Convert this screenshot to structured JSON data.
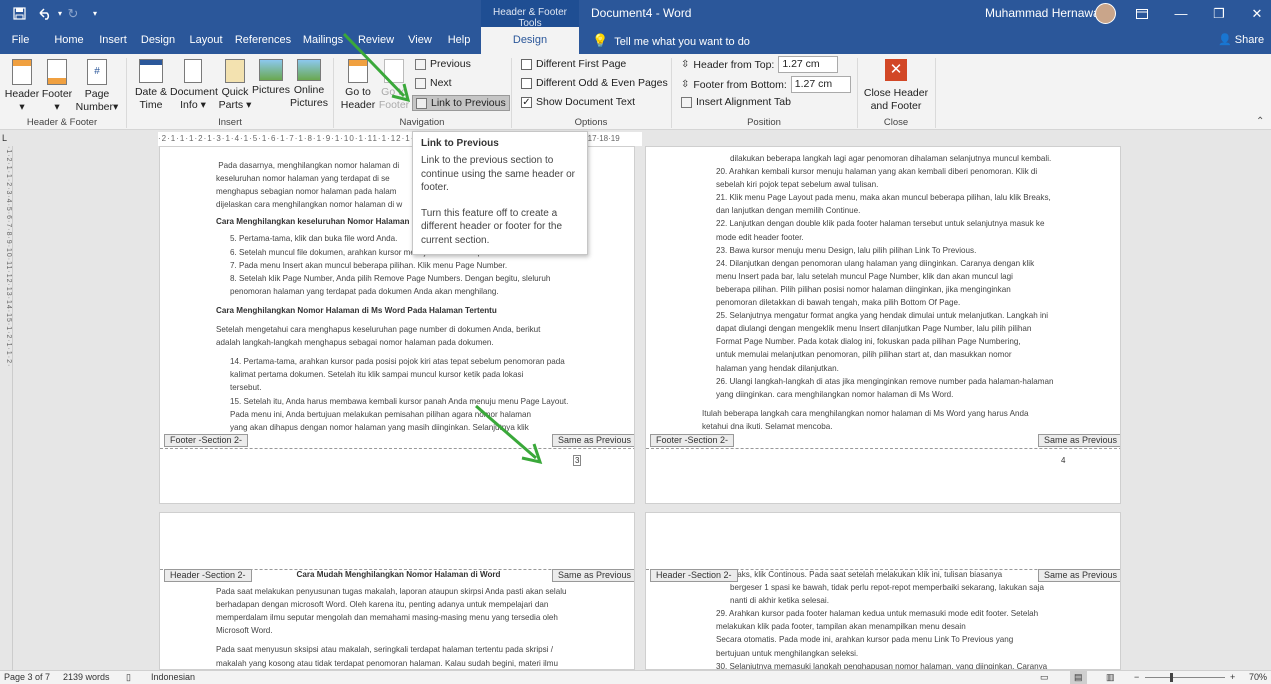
{
  "title_bar": {
    "contextual_tab_group": "Header & Footer Tools",
    "document_title": "Document4 - Word",
    "user_name": "Muhammad Hernawan"
  },
  "tabs": [
    {
      "label": "File"
    },
    {
      "label": "Home"
    },
    {
      "label": "Insert"
    },
    {
      "label": "Design"
    },
    {
      "label": "Layout"
    },
    {
      "label": "References"
    },
    {
      "label": "Mailings"
    },
    {
      "label": "Review"
    },
    {
      "label": "View"
    },
    {
      "label": "Help"
    },
    {
      "label": "Design",
      "active": true
    }
  ],
  "tell_me": "Tell me what you want to do",
  "share": "Share",
  "ribbon": {
    "header_footer": {
      "label": "Header & Footer",
      "header": "Header",
      "footer": "Footer",
      "page_number_1": "Page",
      "page_number_2": "Number"
    },
    "insert": {
      "label": "Insert",
      "date_1": "Date &",
      "date_2": "Time",
      "docinfo_1": "Document",
      "docinfo_2": "Info",
      "quick_1": "Quick",
      "quick_2": "Parts",
      "pictures": "Pictures",
      "online_1": "Online",
      "online_2": "Pictures"
    },
    "navigation": {
      "label": "Navigation",
      "goto_header_1": "Go to",
      "goto_header_2": "Header",
      "goto_footer_1": "Go to",
      "goto_footer_2": "Footer",
      "previous": "Previous",
      "next": "Next",
      "link_to_previous": "Link to Previous"
    },
    "options": {
      "label": "Options",
      "diff_first": "Different First Page",
      "diff_odd_even": "Different Odd & Even Pages",
      "show_doc_text": "Show Document Text",
      "show_doc_text_checked": true
    },
    "position": {
      "label": "Position",
      "header_from_top_label": "Header from Top:",
      "header_from_top": "1.27 cm",
      "footer_from_bottom_label": "Footer from Bottom:",
      "footer_from_bottom": "1.27 cm",
      "insert_alignment_tab": "Insert Alignment Tab"
    },
    "close": {
      "label": "Close",
      "close_1": "Close Header",
      "close_2": "and Footer"
    }
  },
  "tooltip": {
    "title": "Link to Previous",
    "p1": "Link to the previous section to continue using the same header or footer.",
    "p2": "Turn this feature off to create a different header or footer for the current section."
  },
  "ruler": {
    "top": "·2·1·1·1·2·1·3·1·4·1·5·1·6·1·7·1·8·1·9·1·10·1·11·1·12·1·13·1·14·1·15·1·16",
    "top_end": "·17·18·19"
  },
  "pages": {
    "p3_body": {
      "para1_l1": "Pada dasarnya, menghilangkan nomor halaman di",
      "para1_l2": "keseluruhan nomor halaman yang terdapat di se",
      "para1_l3": "menghapus sebagian nomor halaman pada halam",
      "para1_l4": "dijelaskan cara menghilangkan nomor halaman di w",
      "heading1": "Cara Menghilangkan keseluruhan Nomor Halaman",
      "li5": "5.   Pertama-tama, klik dan buka file word Anda.",
      "li6": "6.   Setelah muncul file dokumen, arahkan kursor menuju menu Insert pada bar.",
      "li7": "7.   Pada menu Insert akan muncul beberapa pilihan. Klik menu Page Number.",
      "li8a": "8.   Setelah klik Page Number, Anda pilih Remove Page Numbers. Dengan begitu, sleluruh",
      "li8b": "      penomoran halaman yang terdapat pada dokumen Anda akan menghilang.",
      "heading2": "Cara Menghilangkan Nomor Halaman di Ms Word Pada Halaman Tertentu",
      "para2_l1": "Setelah mengetahui cara menghapus keseluruhan page number di dokumen Anda, berikut",
      "para2_l2": "adalah langkah-langkah menghapus sebagai nomor halaman pada dokumen.",
      "li14a": "14. Pertama-tama, arahkan kursor pada posisi pojok kiri atas tepat sebelum penomoran pada",
      "li14b": "      kalimat pertama dokumen. Setelah itu klik sampai muncul kursor ketik pada lokasi",
      "li14c": "      tersebut.",
      "li15a": "15. Setelah itu, Anda harus membawa kembali kursor panah Anda menuju menu Page Layout.",
      "li15b": "      Pada menu ini, Anda bertujuan melakukan pemisahan pilihan agara nomor halaman",
      "li15c": "      yang akan dihapus dengan nomor halaman yang masih diinginkan. Selanjutnya klik"
    },
    "p4_body": {
      "l0": "dilakukan beberapa langkah lagi agar penomoran dihalaman selanjutnya muncul kembali.",
      "li20a": "20. Arahkan kembali kursor menuju halaman yang akan kembali diberi penomoran. Klik di",
      "li20b": "      sebelah kiri pojok tepat sebelum awal tulisan.",
      "li21a": "21. Klik menu Page Layout pada menu, maka akan muncul beberapa pilihan, lalu klik Breaks,",
      "li21b": "      dan lanjutkan dengan memilih Continue.",
      "li22a": "22. Lanjutkan dengan double klik pada footer halaman tersebut untuk selanjutnya masuk ke",
      "li22b": "      mode edit header footer.",
      "li23": "23. Bawa kursor menuju menu Design, lalu pilih pilihan Link To Previous.",
      "li24a": "24. Dilanjutkan dengan penomoran ulang halaman yang diinginkan. Caranya dengan klik",
      "li24b": "      menu Insert pada bar, lalu setelah muncul Page Number, klik dan akan muncul lagi",
      "li24c": "      beberapa pilihan. Pilih pilihan posisi nomor halaman diinginkan, jika menginginkan",
      "li24d": "      penomoran diletakkan di bawah tengah, maka pilih Bottom Of Page.",
      "li25a": "25. Selanjutnya mengatur format angka yang hendak dimulai untuk melanjutkan. Langkah ini",
      "li25b": "      dapat diulangi dengan mengeklik menu Insert dilanjutkan Page Number, lalu pilih pilihan",
      "li25c": "      Format Page Number. Pada kotak dialog ini, fokuskan pada pilihan Page Numbering,",
      "li25d": "      untuk memulai melanjutkan penomoran, pilih pilihan start at, dan masukkan nomor",
      "li25e": "      halaman yang hendak dilanjutkan.",
      "li26a": "26. Ulangi langkah-langkah di atas jika menginginkan remove number pada halaman-halaman",
      "li26b": "      yang diinginkan.  cara menghilangkan nomor halaman di Ms Word.",
      "end1": "Itulah beberapa langkah cara menghilangkan nomor halaman di Ms Word yang harus Anda",
      "end2": "ketahui dna ikuti. Selamat mencoba."
    },
    "p5_body": {
      "heading": "Cara Mudah Menghilangkan Nomor Halaman di Word",
      "l1": "Pada saat melakukan penyusunan tugas makalah, laporan ataupun skirpsi Anda pasti akan selalu",
      "l2": "berhadapan dengan microsoft Word. Oleh karena itu, penting adanya untuk mempelajari dan",
      "l3": "memperdalam ilmu seputar mengolah dan memahami masing-masing menu yang tersedia oleh",
      "l4": "Microsoft Word.",
      "l5": "Pada saat menyusun sksipsi atau makalah, seringkali terdapat halaman tertentu pada skripsi /",
      "l6": "makalah yang kosong atau tidak terdapat penomoran halaman. Kalau sudah begini, materi ilmu"
    },
    "p6_body": {
      "l0": "reaks, klik Continous. Pada saat setelah melakukan klik ini, tulisan biasanya",
      "l1": "bergeser 1 spasi ke bawah, tidak perlu repot-repot memperbaiki sekarang, lakukan saja",
      "l2": "nanti di akhir ketika selesai.",
      "li29a": "29. Arahkan kursor pada footer halaman kedua untuk memasuki mode edit footer. Setelah",
      "li29b": "      melakukan klik pada footer, tampilan akan menampilkan menu desain",
      "l3": "      Secara otomatis. Pada mode ini, arahkan kursor pada menu Link To Previous yang",
      "l4": "      bertujuan untuk menghilangkan seleksi.",
      "li30": "30. Selanjutnya memasuki langkah penghapusan nomor halaman, yang diinginkan. Caranya"
    },
    "footer_tag_p3": "Footer -Section 2-",
    "footer_tag_p4": "Footer -Section 2-",
    "header_tag_p5": "Header -Section 2-",
    "header_tag_p6": "Header -Section 2-",
    "same_as_previous": "Same as Previous",
    "page_num_3": "3",
    "page_num_4": "4"
  },
  "status": {
    "page": "Page 3 of 7",
    "words": "2139 words",
    "language": "Indonesian",
    "zoom": "70%"
  },
  "colors": {
    "word_blue": "#2b579a",
    "annotation_arrow": "#3aa83a"
  }
}
